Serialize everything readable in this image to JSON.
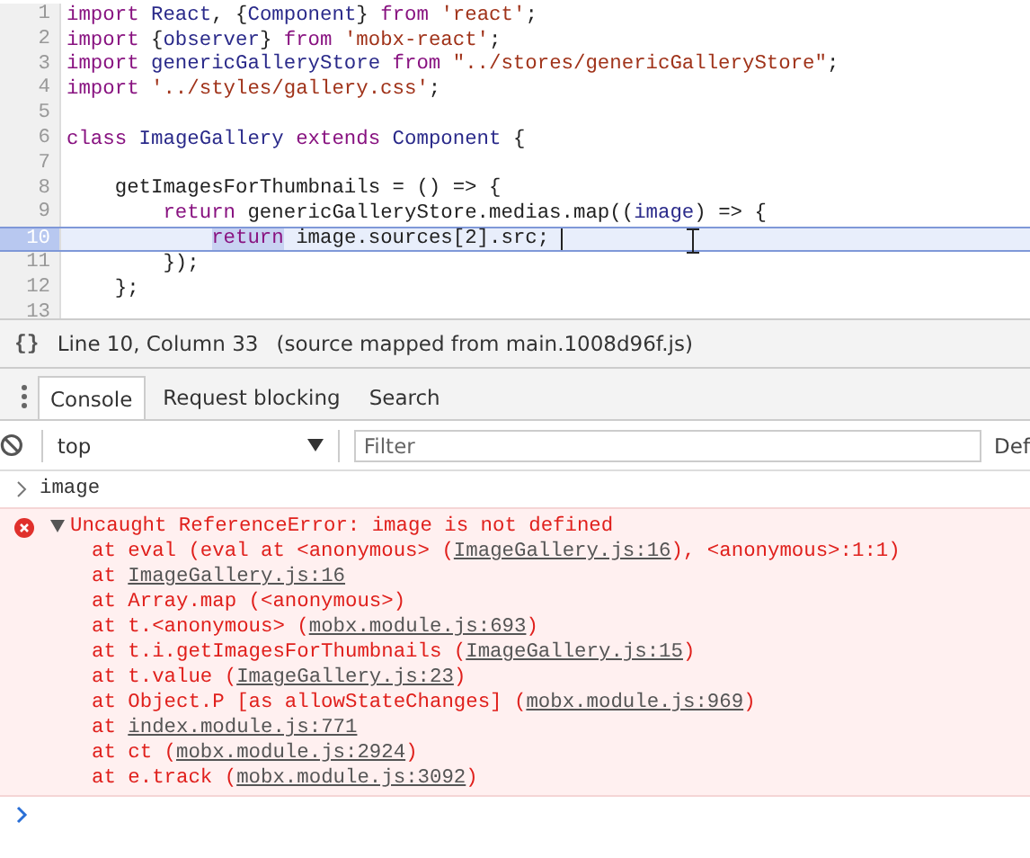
{
  "editor": {
    "lines": [
      {
        "number": "1",
        "selected": false,
        "tokens": [
          {
            "kind": "kw",
            "text": "import "
          },
          {
            "kind": "def",
            "text": "React"
          },
          {
            "kind": "plain",
            "text": ", {"
          },
          {
            "kind": "def",
            "text": "Component"
          },
          {
            "kind": "plain",
            "text": "} "
          },
          {
            "kind": "kw",
            "text": "from "
          },
          {
            "kind": "str",
            "text": "'react'"
          },
          {
            "kind": "plain",
            "text": ";"
          }
        ]
      },
      {
        "number": "2",
        "selected": false,
        "tokens": [
          {
            "kind": "kw",
            "text": "import "
          },
          {
            "kind": "plain",
            "text": "{"
          },
          {
            "kind": "def",
            "text": "observer"
          },
          {
            "kind": "plain",
            "text": "} "
          },
          {
            "kind": "kw",
            "text": "from "
          },
          {
            "kind": "str",
            "text": "'mobx-react'"
          },
          {
            "kind": "plain",
            "text": ";"
          }
        ]
      },
      {
        "number": "3",
        "selected": false,
        "tokens": [
          {
            "kind": "kw",
            "text": "import "
          },
          {
            "kind": "def",
            "text": "genericGalleryStore "
          },
          {
            "kind": "kw",
            "text": "from "
          },
          {
            "kind": "str",
            "text": "\"../stores/genericGalleryStore\""
          },
          {
            "kind": "plain",
            "text": ";"
          }
        ]
      },
      {
        "number": "4",
        "selected": false,
        "tokens": [
          {
            "kind": "kw",
            "text": "import "
          },
          {
            "kind": "str",
            "text": "'../styles/gallery.css'"
          },
          {
            "kind": "plain",
            "text": ";"
          }
        ]
      },
      {
        "number": "5",
        "selected": false
      },
      {
        "number": "6",
        "selected": false,
        "tokens": [
          {
            "kind": "kw",
            "text": "class "
          },
          {
            "kind": "def",
            "text": "ImageGallery "
          },
          {
            "kind": "kw",
            "text": "extends "
          },
          {
            "kind": "def",
            "text": "Component "
          },
          {
            "kind": "plain",
            "text": "{"
          }
        ]
      },
      {
        "number": "7",
        "selected": false
      },
      {
        "number": "8",
        "selected": false,
        "tokens": [
          {
            "kind": "plain",
            "text": "    getImagesForThumbnails = () => {"
          }
        ]
      },
      {
        "number": "9",
        "selected": false,
        "tokens": [
          {
            "kind": "kw",
            "text": "        return "
          },
          {
            "kind": "plain",
            "text": "genericGalleryStore.medias.map(("
          },
          {
            "kind": "def",
            "text": "image"
          },
          {
            "kind": "plain",
            "text": ") => {"
          }
        ]
      },
      {
        "number": "10",
        "selected": true,
        "tokens": [
          {
            "kind": "kw_match",
            "text": "            return"
          },
          {
            "kind": "plain",
            "text": " image.sources[2].src; "
          }
        ]
      },
      {
        "number": "11",
        "selected": false,
        "tokens": [
          {
            "kind": "plain",
            "text": "        });"
          }
        ]
      },
      {
        "number": "12",
        "selected": false,
        "tokens": [
          {
            "kind": "plain",
            "text": "    };"
          }
        ]
      },
      {
        "number": "13",
        "selected": false
      }
    ]
  },
  "status_bar": {
    "icon": "{}",
    "position": "Line 10, Column 33",
    "source": "(source mapped from main.1008d96f.js)"
  },
  "tabs": [
    {
      "label": "Console",
      "selected": true
    },
    {
      "label": "Request blocking",
      "selected": false
    },
    {
      "label": "Search",
      "selected": false
    }
  ],
  "toolbar": {
    "context": "top",
    "filter": {
      "placeholder": "Filter"
    },
    "levels": "Def"
  },
  "console": {
    "input": "image",
    "error": {
      "message": "Uncaught ReferenceError: image is not defined",
      "expanded": true,
      "stack": [
        [
          {
            "kind": "text",
            "text": "at eval (eval at <anonymous> ("
          },
          {
            "kind": "link",
            "text": "ImageGallery.js:16"
          },
          {
            "kind": "text",
            "text": "), <anonymous>:1:1)"
          }
        ],
        [
          {
            "kind": "text",
            "text": "at "
          },
          {
            "kind": "link",
            "text": "ImageGallery.js:16"
          }
        ],
        [
          {
            "kind": "text",
            "text": "at Array.map (<anonymous>)"
          }
        ],
        [
          {
            "kind": "text",
            "text": "at t.<anonymous> ("
          },
          {
            "kind": "link",
            "text": "mobx.module.js:693"
          },
          {
            "kind": "text",
            "text": ")"
          }
        ],
        [
          {
            "kind": "text",
            "text": "at t.i.getImagesForThumbnails ("
          },
          {
            "kind": "link",
            "text": "ImageGallery.js:15"
          },
          {
            "kind": "text",
            "text": ")"
          }
        ],
        [
          {
            "kind": "text",
            "text": "at t.value ("
          },
          {
            "kind": "link",
            "text": "ImageGallery.js:23"
          },
          {
            "kind": "text",
            "text": ")"
          }
        ],
        [
          {
            "kind": "text",
            "text": "at Object.P [as allowStateChanges] ("
          },
          {
            "kind": "link",
            "text": "mobx.module.js:969"
          },
          {
            "kind": "text",
            "text": ")"
          }
        ],
        [
          {
            "kind": "text",
            "text": "at "
          },
          {
            "kind": "link",
            "text": "index.module.js:771"
          }
        ],
        [
          {
            "kind": "text",
            "text": "at ct ("
          },
          {
            "kind": "link",
            "text": "mobx.module.js:2924"
          },
          {
            "kind": "text",
            "text": ")"
          }
        ],
        [
          {
            "kind": "text",
            "text": "at e.track ("
          },
          {
            "kind": "link",
            "text": "mobx.module.js:3092"
          },
          {
            "kind": "text",
            "text": ")"
          }
        ]
      ]
    }
  }
}
